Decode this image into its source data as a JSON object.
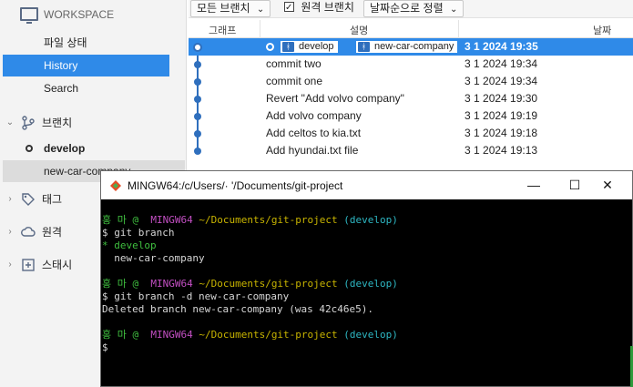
{
  "sidebar": {
    "workspace_label": "WORKSPACE",
    "items": [
      {
        "label": "파일 상태"
      },
      {
        "label": "History"
      },
      {
        "label": "Search"
      }
    ],
    "branches_label": "브랜치",
    "branches": [
      {
        "name": "develop"
      },
      {
        "name": "new-car-company"
      }
    ],
    "tags_label": "태그",
    "remotes_label": "원격",
    "stashes_label": "스태시"
  },
  "toolbar": {
    "all_branches": "모든 브랜치",
    "remote_branches": "원격 브랜치",
    "sort_by_date": "날짜순으로 정렬"
  },
  "columns": {
    "graph": "그래프",
    "description": "설명",
    "date": "날짜"
  },
  "commits": [
    {
      "message": "",
      "date": "3 1 2024 19:35",
      "refs": [
        "develop",
        "new-car-company"
      ]
    },
    {
      "message": "commit two",
      "date": "3 1 2024 19:34"
    },
    {
      "message": "commit one",
      "date": "3 1 2024 19:34"
    },
    {
      "message": "Revert \"Add volvo company\"",
      "date": "3 1 2024 19:30"
    },
    {
      "message": "Add volvo company",
      "date": "3 1 2024 19:19"
    },
    {
      "message": "Add celtos to kia.txt",
      "date": "3 1 2024 19:18"
    },
    {
      "message": "Add hyundai.txt file",
      "date": "3 1 2024 19:13"
    }
  ],
  "terminal": {
    "title": "MINGW64:/c/Users/·     '/Documents/git-project",
    "prompt_user": "홍 마 @",
    "prompt_host": "MINGW64",
    "prompt_path": "~/Documents/git-project",
    "prompt_branch": "(develop)",
    "lines": {
      "cmd1": "$ git branch",
      "out1a": "* develop",
      "out1b": "  new-car-company",
      "cmd2": "$ git branch -d new-car-company",
      "out2": "Deleted branch new-car-company (was 42c46e5).",
      "cmd3": "$"
    }
  },
  "colors": {
    "accent": "#2f8ae8",
    "graph": "#2f6fbd",
    "term_green": "#3fbf3f",
    "term_magenta": "#c24fc2",
    "term_yellow": "#c8b400",
    "term_cyan": "#2eb8c4"
  }
}
